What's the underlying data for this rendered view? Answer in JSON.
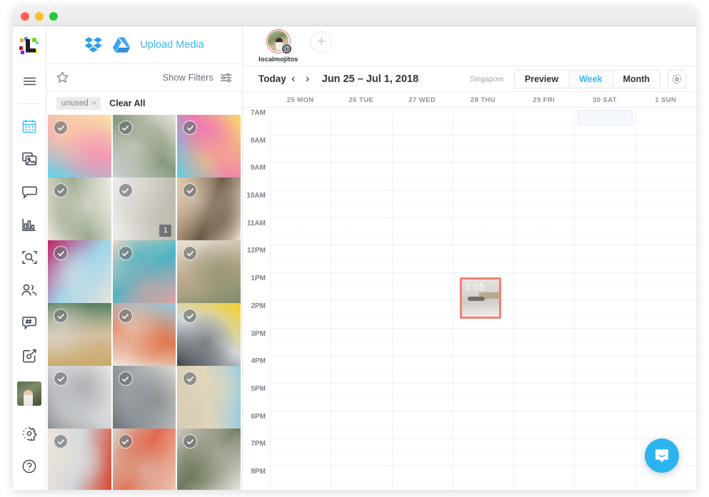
{
  "window": {
    "traffic_lights": [
      "close",
      "minimize",
      "zoom"
    ]
  },
  "rail": {
    "logo_name": "later-logo",
    "menu_label": "≡",
    "items": [
      {
        "name": "calendar",
        "icon": "calendar-icon",
        "active": true
      },
      {
        "name": "media",
        "icon": "media-library-icon",
        "active": false
      },
      {
        "name": "conversations",
        "icon": "conversations-icon",
        "active": false
      },
      {
        "name": "analytics",
        "icon": "analytics-icon",
        "active": false
      },
      {
        "name": "discover",
        "icon": "search-grid-icon",
        "active": false
      },
      {
        "name": "users",
        "icon": "users-icon",
        "active": false
      },
      {
        "name": "hashtags",
        "icon": "hashtag-icon",
        "active": false
      },
      {
        "name": "linkin-bio",
        "icon": "link-bio-icon",
        "active": false
      }
    ],
    "settings_label": "settings",
    "help_label": "help"
  },
  "media_panel": {
    "dropbox_label": "Dropbox",
    "gdrive_label": "Google Drive",
    "upload_label": "Upload Media",
    "star_label": "Starred",
    "show_filters_label": "Show Filters",
    "chips": [
      {
        "label": "unused",
        "remove": "×"
      }
    ],
    "clear_all_label": "Clear All",
    "tiles": [
      {
        "id": 1,
        "alt": "pool float flamingo",
        "checked": true,
        "count": null,
        "c1": "#5fd7e8",
        "c2": "#f39ab4",
        "c3": "#fbe6a4"
      },
      {
        "id": 2,
        "alt": "couple by car desert",
        "checked": true,
        "count": null,
        "c1": "#cfd5d8",
        "c2": "#8a9a7d",
        "c3": "#e8e4dd"
      },
      {
        "id": 3,
        "alt": "pool float donut",
        "checked": true,
        "count": null,
        "c1": "#56d2e6",
        "c2": "#ef7ab2",
        "c3": "#f9d96a"
      },
      {
        "id": 4,
        "alt": "person in field",
        "checked": true,
        "count": null,
        "c1": "#e7e3da",
        "c2": "#9aa98c",
        "c3": "#f2efe8"
      },
      {
        "id": 5,
        "alt": "flatlay marble",
        "checked": true,
        "count": "1",
        "c1": "#efeeea",
        "c2": "#d8d5ce",
        "c3": "#bdb9b0"
      },
      {
        "id": 6,
        "alt": "brunch table",
        "checked": true,
        "count": null,
        "c1": "#e4c9a6",
        "c2": "#6b5a47",
        "c3": "#f1e3cf"
      },
      {
        "id": 7,
        "alt": "cyclist by bougainvillea",
        "checked": true,
        "count": null,
        "c1": "#c5256c",
        "c2": "#9fd4ea",
        "c3": "#e8e4de"
      },
      {
        "id": 8,
        "alt": "friends with phones",
        "checked": true,
        "count": null,
        "c1": "#ead7c5",
        "c2": "#4cb3c4",
        "c3": "#e2a2a0"
      },
      {
        "id": 9,
        "alt": "desk flatlay plant",
        "checked": true,
        "count": null,
        "c1": "#e9e5dc",
        "c2": "#b9a889",
        "c3": "#7d8a6b"
      },
      {
        "id": 10,
        "alt": "cafe green door",
        "checked": true,
        "count": null,
        "c1": "#4e7a56",
        "c2": "#d9cfc0",
        "c3": "#c9a767"
      },
      {
        "id": 11,
        "alt": "friends by white car",
        "checked": true,
        "count": null,
        "c1": "#9cc9dd",
        "c2": "#e07a50",
        "c3": "#efe9e1"
      },
      {
        "id": 12,
        "alt": "yellow tent festival",
        "checked": true,
        "count": null,
        "c1": "#f3cf2c",
        "c2": "#cfd6da",
        "c3": "#3b3f46"
      },
      {
        "id": 13,
        "alt": "bright studio interior",
        "checked": true,
        "count": null,
        "c1": "#eceaea",
        "c2": "#cfd2d5",
        "c3": "#8d8f93"
      },
      {
        "id": 14,
        "alt": "pier and stairs",
        "checked": true,
        "count": null,
        "c1": "#d9d6cf",
        "c2": "#9fa6ab",
        "c3": "#6f757a"
      },
      {
        "id": 15,
        "alt": "beach crowd",
        "checked": true,
        "count": null,
        "c1": "#8ecbe8",
        "c2": "#e3d7bb",
        "c3": "#d7cdb4"
      },
      {
        "id": 16,
        "alt": "red architecture",
        "checked": true,
        "count": null,
        "c1": "#d8452e",
        "c2": "#cfd6dc",
        "c3": "#efe3d9"
      },
      {
        "id": 17,
        "alt": "floral wall",
        "checked": true,
        "count": null,
        "c1": "#f0c9b6",
        "c2": "#e06b4f",
        "c3": "#d9d2c5"
      },
      {
        "id": 18,
        "alt": "white buildings tree",
        "checked": true,
        "count": null,
        "c1": "#ece9e3",
        "c2": "#6f7a5f",
        "c3": "#cfc9bd"
      }
    ]
  },
  "calendar": {
    "profile": {
      "name": "localmojitos",
      "network_icon": "instagram-icon"
    },
    "add_profile_label": "+",
    "today_label": "Today",
    "prev_label": "‹",
    "next_label": "›",
    "date_range": "Jun 25 – Jul 1, 2018",
    "timezone": "Singapore",
    "view_tabs": [
      {
        "label": "Preview",
        "active": false
      },
      {
        "label": "Week",
        "active": true
      },
      {
        "label": "Month",
        "active": false
      }
    ],
    "settings_icon": "gear-icon",
    "days": [
      {
        "label": "25 MON"
      },
      {
        "label": "26 TUE"
      },
      {
        "label": "27 WED"
      },
      {
        "label": "28 THU"
      },
      {
        "label": "29 FRI"
      },
      {
        "label": "30 SAT"
      },
      {
        "label": "1 SUN"
      }
    ],
    "hours": [
      "7AM",
      "8AM",
      "9AM",
      "10AM",
      "11AM",
      "12PM",
      "1PM",
      "2PM",
      "3PM",
      "4PM",
      "5PM",
      "6PM",
      "7PM",
      "8PM"
    ],
    "ghost_slot": {
      "day_index": 5,
      "hour_index": 0
    },
    "events": [
      {
        "time_label": "1:05",
        "day_index": 3,
        "hour_index": 6,
        "accent": "#ef8178"
      }
    ]
  },
  "support": {
    "intercom_label": "Open chat"
  },
  "colors": {
    "accent_blue": "#3fb6f2",
    "event_red": "#ef8178",
    "intercom_blue": "#2cb4f0",
    "text_dark": "#2f333a",
    "text_muted": "#8d9299"
  }
}
